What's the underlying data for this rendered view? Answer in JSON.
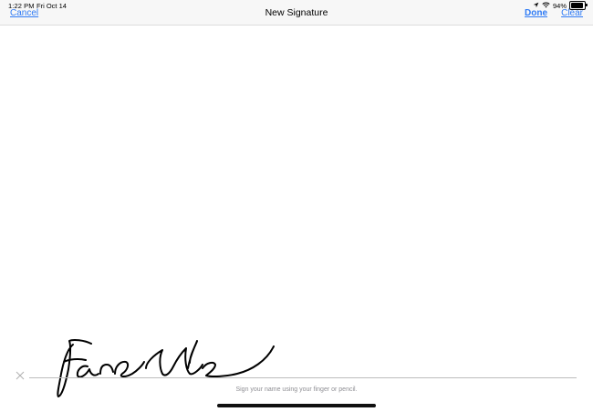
{
  "status_bar": {
    "time": "1:22 PM",
    "date": "Fri Oct 14",
    "battery": "94%",
    "battery_level": 0.94
  },
  "nav": {
    "title": "New Signature",
    "cancel_label": "Cancel",
    "done_label": "Done",
    "clear_label": "Clear"
  },
  "signature": {
    "hint": "Sign your name using your finger or pencil."
  },
  "icons": {
    "location": "location-arrow-icon",
    "wifi": "wifi-icon",
    "battery": "battery-icon",
    "clear": "close-icon"
  },
  "colors": {
    "accent": "#2f7bf5",
    "bar_background": "#f7f7f7",
    "hint_text": "#8e8e93"
  }
}
